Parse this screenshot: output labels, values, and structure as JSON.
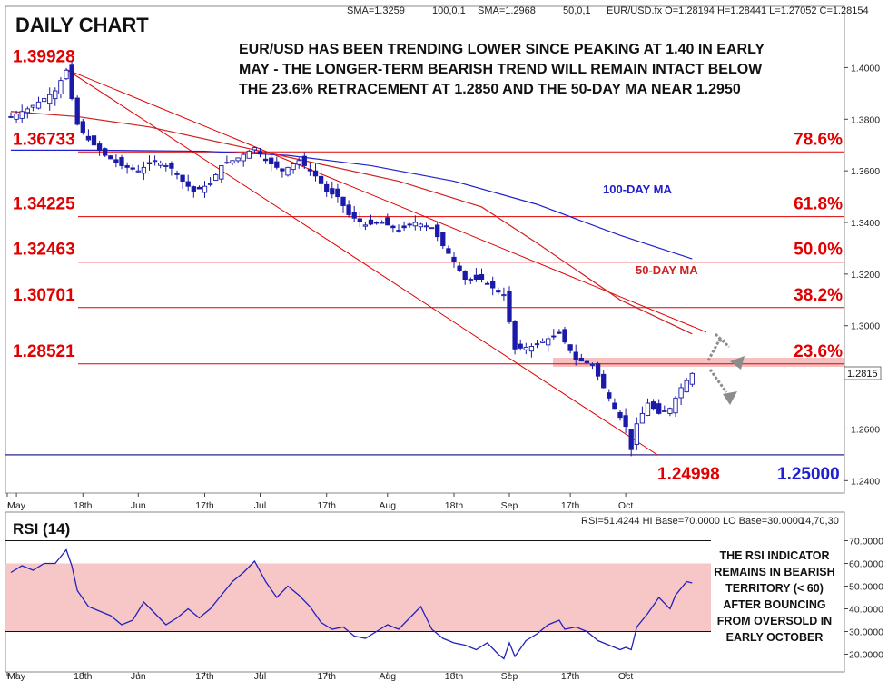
{
  "chart_data": [
    {
      "type": "candlestick",
      "title": "DAILY CHART",
      "header": {
        "sma_long": "SMA=1.3259",
        "sma_long_params": "100,0,1",
        "sma_short": "SMA=1.2968",
        "sma_short_params": "50,0,1",
        "quote": "EUR/USD.fx O=1.28194 H=1.28441 L=1.27052 C=1.28154"
      },
      "annotation": [
        "EUR/USD HAS BEEN TRENDING LOWER SINCE PEAKING AT 1.40 IN EARLY",
        "MAY - THE LONGER-TERM BEARISH TREND WILL REMAIN INTACT BELOW",
        "THE 23.6% RETRACEMENT AT 1.2850 AND THE 50-DAY MA NEAR 1.2950"
      ],
      "ylim": [
        1.238,
        1.41
      ],
      "y_ticks": [
        "1.4000",
        "1.3800",
        "1.3600",
        "1.3400",
        "1.3200",
        "1.3000",
        "1.2600",
        "1.2400"
      ],
      "x_ticks": [
        {
          "label": "r",
          "i": -2
        },
        {
          "label": "May",
          "i": 1
        },
        {
          "label": "18th",
          "i": 13
        },
        {
          "label": "Jun",
          "i": 23
        },
        {
          "label": "17th",
          "i": 35
        },
        {
          "label": "Jul",
          "i": 45
        },
        {
          "label": "17th",
          "i": 57
        },
        {
          "label": "Aug",
          "i": 68
        },
        {
          "label": "18th",
          "i": 80
        },
        {
          "label": "Sep",
          "i": 90
        },
        {
          "label": "17th",
          "i": 101
        },
        {
          "label": "Oct",
          "i": 111
        }
      ],
      "current_price": "1.2815",
      "fib_levels": [
        {
          "price_label": "1.39928",
          "pct_label": "",
          "value": 1.39928
        },
        {
          "price_label": "1.36733",
          "pct_label": "78.6%",
          "value": 1.36733
        },
        {
          "price_label": "1.34225",
          "pct_label": "61.8%",
          "value": 1.34225
        },
        {
          "price_label": "1.32463",
          "pct_label": "50.0%",
          "value": 1.32463
        },
        {
          "price_label": "1.30701",
          "pct_label": "38.2%",
          "value": 1.30701
        },
        {
          "price_label": "1.28521",
          "pct_label": "23.6%",
          "value": 1.28521
        }
      ],
      "low_label": "1.24998",
      "support_label": "1.25000",
      "support_value": 1.25,
      "ma_labels": {
        "ma100": "100-DAY MA",
        "ma50": "50-DAY MA"
      },
      "anchors": [
        {
          "i": 0,
          "c": 1.381
        },
        {
          "i": 3,
          "c": 1.384
        },
        {
          "i": 6,
          "c": 1.388
        },
        {
          "i": 8,
          "c": 1.391
        },
        {
          "i": 10,
          "c": 1.399
        },
        {
          "i": 11,
          "c": 1.388
        },
        {
          "i": 12,
          "c": 1.378
        },
        {
          "i": 14,
          "c": 1.372
        },
        {
          "i": 17,
          "c": 1.366
        },
        {
          "i": 20,
          "c": 1.362
        },
        {
          "i": 23,
          "c": 1.36
        },
        {
          "i": 26,
          "c": 1.364
        },
        {
          "i": 29,
          "c": 1.361
        },
        {
          "i": 31,
          "c": 1.356
        },
        {
          "i": 33,
          "c": 1.352
        },
        {
          "i": 36,
          "c": 1.355
        },
        {
          "i": 38,
          "c": 1.362
        },
        {
          "i": 41,
          "c": 1.365
        },
        {
          "i": 44,
          "c": 1.369
        },
        {
          "i": 46,
          "c": 1.364
        },
        {
          "i": 49,
          "c": 1.36
        },
        {
          "i": 52,
          "c": 1.364
        },
        {
          "i": 55,
          "c": 1.358
        },
        {
          "i": 57,
          "c": 1.352
        },
        {
          "i": 59,
          "c": 1.35
        },
        {
          "i": 61,
          "c": 1.343
        },
        {
          "i": 64,
          "c": 1.339
        },
        {
          "i": 67,
          "c": 1.34
        },
        {
          "i": 70,
          "c": 1.337
        },
        {
          "i": 73,
          "c": 1.34
        },
        {
          "i": 76,
          "c": 1.338
        },
        {
          "i": 78,
          "c": 1.331
        },
        {
          "i": 80,
          "c": 1.325
        },
        {
          "i": 82,
          "c": 1.318
        },
        {
          "i": 85,
          "c": 1.318
        },
        {
          "i": 88,
          "c": 1.313
        },
        {
          "i": 89,
          "c": 1.312
        },
        {
          "i": 91,
          "c": 1.291
        },
        {
          "i": 94,
          "c": 1.292
        },
        {
          "i": 97,
          "c": 1.295
        },
        {
          "i": 99,
          "c": 1.297
        },
        {
          "i": 102,
          "c": 1.287
        },
        {
          "i": 105,
          "c": 1.285
        },
        {
          "i": 107,
          "c": 1.276
        },
        {
          "i": 109,
          "c": 1.268
        },
        {
          "i": 111,
          "c": 1.261
        },
        {
          "i": 112,
          "c": 1.252
        },
        {
          "i": 113,
          "c": 1.262
        },
        {
          "i": 115,
          "c": 1.27
        },
        {
          "i": 117,
          "c": 1.266
        },
        {
          "i": 119,
          "c": 1.268
        },
        {
          "i": 121,
          "c": 1.276
        },
        {
          "i": 123,
          "c": 1.2815
        }
      ],
      "sma100_path": [
        {
          "i": 0,
          "v": 1.368
        },
        {
          "i": 15,
          "v": 1.368
        },
        {
          "i": 35,
          "v": 1.3676
        },
        {
          "i": 50,
          "v": 1.366
        },
        {
          "i": 65,
          "v": 1.362
        },
        {
          "i": 80,
          "v": 1.356
        },
        {
          "i": 95,
          "v": 1.347
        },
        {
          "i": 110,
          "v": 1.335
        },
        {
          "i": 123,
          "v": 1.3259
        }
      ],
      "sma50_path": [
        {
          "i": 0,
          "v": 1.383
        },
        {
          "i": 12,
          "v": 1.381
        },
        {
          "i": 25,
          "v": 1.377
        },
        {
          "i": 40,
          "v": 1.37
        },
        {
          "i": 55,
          "v": 1.363
        },
        {
          "i": 70,
          "v": 1.356
        },
        {
          "i": 85,
          "v": 1.346
        },
        {
          "i": 95,
          "v": 1.332
        },
        {
          "i": 110,
          "v": 1.31
        },
        {
          "i": 123,
          "v": 1.2968
        }
      ],
      "trendlines": [
        {
          "i1": 10,
          "v1": 1.3993,
          "i2": 114,
          "v2": 1.25
        },
        {
          "i1": 10,
          "v1": 1.3993,
          "i2": 114,
          "v2": 1.25
        }
      ]
    },
    {
      "type": "line",
      "title": "RSI (14)",
      "header": "RSI=51.4244 HI Base=70.0000 LO Base=30.0000",
      "header_params": "14,70,30",
      "ylim": [
        15,
        77
      ],
      "y_ticks": [
        "70.0000",
        "60.0000",
        "50.0000",
        "40.0000",
        "30.0000",
        "20.0000"
      ],
      "hi_base": 70,
      "lo_base": 30,
      "band": [
        30,
        60
      ],
      "note": [
        "THE RSI INDICATOR",
        "REMAINS IN BEARISH",
        "TERRITORY (< 60)",
        "AFTER BOUNCING",
        "FROM OVERSOLD IN",
        "EARLY OCTOBER"
      ],
      "x_ticks": [
        {
          "label": "r",
          "i": -2
        },
        {
          "label": "May",
          "i": 1
        },
        {
          "label": "18th",
          "i": 13
        },
        {
          "label": "Jun",
          "i": 23
        },
        {
          "label": "17th",
          "i": 35
        },
        {
          "label": "Jul",
          "i": 45
        },
        {
          "label": "17th",
          "i": 57
        },
        {
          "label": "Aug",
          "i": 68
        },
        {
          "label": "18th",
          "i": 80
        },
        {
          "label": "Sep",
          "i": 90
        },
        {
          "label": "17th",
          "i": 101
        },
        {
          "label": "Oct",
          "i": 111
        }
      ],
      "values": [
        {
          "i": 0,
          "v": 56
        },
        {
          "i": 2,
          "v": 59
        },
        {
          "i": 4,
          "v": 57
        },
        {
          "i": 6,
          "v": 60
        },
        {
          "i": 8,
          "v": 60
        },
        {
          "i": 10,
          "v": 66
        },
        {
          "i": 11,
          "v": 59
        },
        {
          "i": 12,
          "v": 48
        },
        {
          "i": 14,
          "v": 41
        },
        {
          "i": 16,
          "v": 39
        },
        {
          "i": 18,
          "v": 37
        },
        {
          "i": 20,
          "v": 33
        },
        {
          "i": 22,
          "v": 35
        },
        {
          "i": 24,
          "v": 43
        },
        {
          "i": 26,
          "v": 38
        },
        {
          "i": 28,
          "v": 33
        },
        {
          "i": 30,
          "v": 36
        },
        {
          "i": 32,
          "v": 40
        },
        {
          "i": 34,
          "v": 36
        },
        {
          "i": 36,
          "v": 40
        },
        {
          "i": 38,
          "v": 46
        },
        {
          "i": 40,
          "v": 52
        },
        {
          "i": 42,
          "v": 56
        },
        {
          "i": 44,
          "v": 61
        },
        {
          "i": 46,
          "v": 52
        },
        {
          "i": 48,
          "v": 45
        },
        {
          "i": 50,
          "v": 50
        },
        {
          "i": 52,
          "v": 46
        },
        {
          "i": 54,
          "v": 41
        },
        {
          "i": 56,
          "v": 34
        },
        {
          "i": 58,
          "v": 31
        },
        {
          "i": 60,
          "v": 32
        },
        {
          "i": 62,
          "v": 28
        },
        {
          "i": 64,
          "v": 27
        },
        {
          "i": 66,
          "v": 30
        },
        {
          "i": 68,
          "v": 33
        },
        {
          "i": 70,
          "v": 31
        },
        {
          "i": 72,
          "v": 36
        },
        {
          "i": 74,
          "v": 41
        },
        {
          "i": 76,
          "v": 31
        },
        {
          "i": 78,
          "v": 27
        },
        {
          "i": 80,
          "v": 25
        },
        {
          "i": 82,
          "v": 24
        },
        {
          "i": 84,
          "v": 22
        },
        {
          "i": 86,
          "v": 25
        },
        {
          "i": 88,
          "v": 20
        },
        {
          "i": 89,
          "v": 18
        },
        {
          "i": 90,
          "v": 25
        },
        {
          "i": 91,
          "v": 19
        },
        {
          "i": 93,
          "v": 26
        },
        {
          "i": 95,
          "v": 29
        },
        {
          "i": 97,
          "v": 33
        },
        {
          "i": 99,
          "v": 35
        },
        {
          "i": 100,
          "v": 31
        },
        {
          "i": 102,
          "v": 32
        },
        {
          "i": 104,
          "v": 30
        },
        {
          "i": 106,
          "v": 26
        },
        {
          "i": 108,
          "v": 24
        },
        {
          "i": 110,
          "v": 22
        },
        {
          "i": 111,
          "v": 23
        },
        {
          "i": 112,
          "v": 22
        },
        {
          "i": 113,
          "v": 32
        },
        {
          "i": 115,
          "v": 38
        },
        {
          "i": 117,
          "v": 45
        },
        {
          "i": 119,
          "v": 40
        },
        {
          "i": 120,
          "v": 46
        },
        {
          "i": 122,
          "v": 52
        },
        {
          "i": 123,
          "v": 51.4
        }
      ]
    }
  ],
  "colors": {
    "candle_up": "#ffffff",
    "candle_down": "#1a1aa8",
    "candle_outline": "#1a1aa8",
    "fib_line": "#e00000",
    "sma100": "#2020d0",
    "sma50": "#d02020",
    "rsi_line": "#2222bb",
    "rsi_band": "#f7c6c6",
    "resistance_band": "#f7c0c0",
    "arrow": "#8c8c8c"
  }
}
